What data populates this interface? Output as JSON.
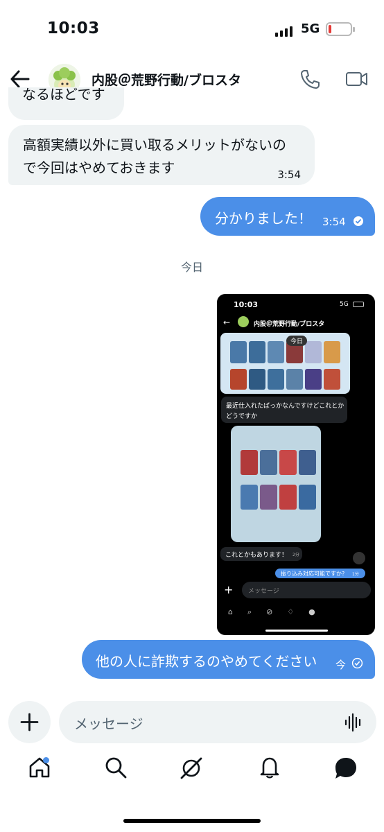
{
  "status": {
    "time": "10:03",
    "network": "5G"
  },
  "header": {
    "name": "内股＠荒野行動/ブロスタ"
  },
  "messages": {
    "partial_text": "なるほどです",
    "received_1": {
      "line1": "高額実績以外に買い取るメリットがないの",
      "line2": "で今回はやめておきます",
      "time": "3:54"
    },
    "sent_1": {
      "text": "分かりました！",
      "time": "3:54"
    },
    "date_divider": "今日",
    "sent_2": {
      "text": "他の人に詐欺するのやめてください",
      "time": "今"
    }
  },
  "embedded": {
    "time": "10:03",
    "network": "5G",
    "name": "内股＠荒野行動/ブロスタ",
    "date_pill": "今日",
    "msg_1_line1": "最近仕入れたばっかなんですけどこれとか",
    "msg_1_line2": "どうですか",
    "msg_2": "これとかもあります！",
    "msg_2_time": "2分",
    "sent_text": "振り込み対応可能ですか?",
    "sent_time": "1分",
    "placeholder": "メッセージ"
  },
  "composer": {
    "placeholder": "メッセージ"
  },
  "colors": {
    "accent": "#4b8fe8",
    "incoming_bg": "#eff3f4",
    "notification_dot": "#4b8fe8"
  }
}
